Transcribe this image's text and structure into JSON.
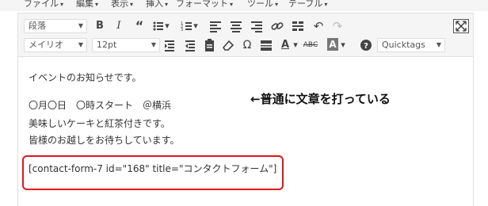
{
  "menubar": {
    "items": [
      "ファイル",
      "編集",
      "表示",
      "挿入",
      "フォーマット",
      "ツール",
      "テーブル"
    ]
  },
  "toolbar": {
    "paragraph_select": "段落",
    "font_select": "メイリオ",
    "size_select": "12pt",
    "quicktags_select": "Quicktags"
  },
  "content": {
    "line1": "イベントのお知らせです。",
    "line2": "〇月〇日　〇時スタート　＠横浜",
    "line3": "美味しいケーキと紅茶付きです。",
    "line4": "皆様のお越しをお待ちしています。",
    "shortcode": "[contact-form-7 id=\"168\" title=\"コンタクトフォーム\"]"
  },
  "annotation": "←普通に文章を打っている",
  "colors": {
    "highlight_border": "#e3151d",
    "toolbar_bg": "#f5f5f5"
  }
}
